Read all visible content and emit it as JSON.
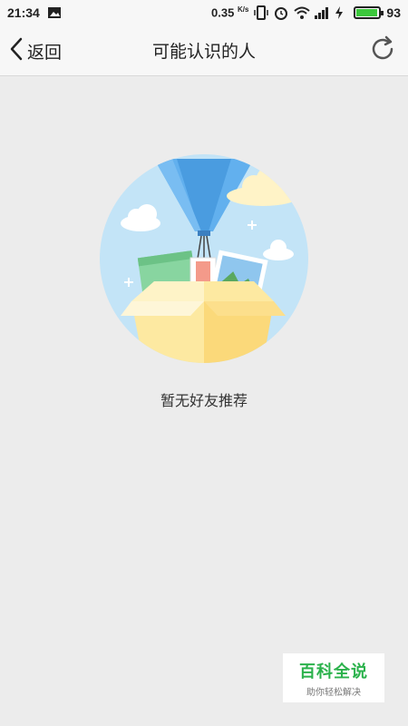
{
  "status_bar": {
    "time": "21:34",
    "speed_value": "0.35",
    "speed_unit": "K/s",
    "battery_percent": "93",
    "battery_level": 0.93,
    "battery_color": "#3cc73c",
    "icons": [
      "image-notification-icon",
      "vibrate-icon",
      "alarm-icon",
      "wifi-icon",
      "signal-icon",
      "charging-icon",
      "battery-icon"
    ]
  },
  "nav": {
    "back_label": "返回",
    "title": "可能认识的人",
    "refresh_icon": "refresh-icon"
  },
  "empty_state": {
    "message": "暂无好友推荐",
    "illustration": "balloon-box-illustration"
  },
  "watermark": {
    "title": "百科全说",
    "subtitle": "助你轻松解决",
    "color": "#2bb24c"
  }
}
